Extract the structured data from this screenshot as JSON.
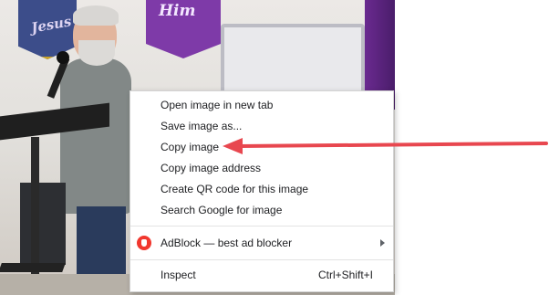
{
  "banners": {
    "left_text": "Jesus",
    "mid_text": "Him"
  },
  "context_menu": {
    "items": [
      {
        "label": "Open image in new tab"
      },
      {
        "label": "Save image as..."
      },
      {
        "label": "Copy image"
      },
      {
        "label": "Copy image address"
      },
      {
        "label": "Create QR code for this image"
      },
      {
        "label": "Search Google for image"
      }
    ],
    "extension_item": {
      "label": "AdBlock — best ad blocker",
      "icon": "adblock-icon",
      "has_submenu": true
    },
    "inspect_item": {
      "label": "Inspect",
      "shortcut": "Ctrl+Shift+I"
    }
  },
  "annotation": {
    "target": "Copy image",
    "color": "#e8474f"
  }
}
